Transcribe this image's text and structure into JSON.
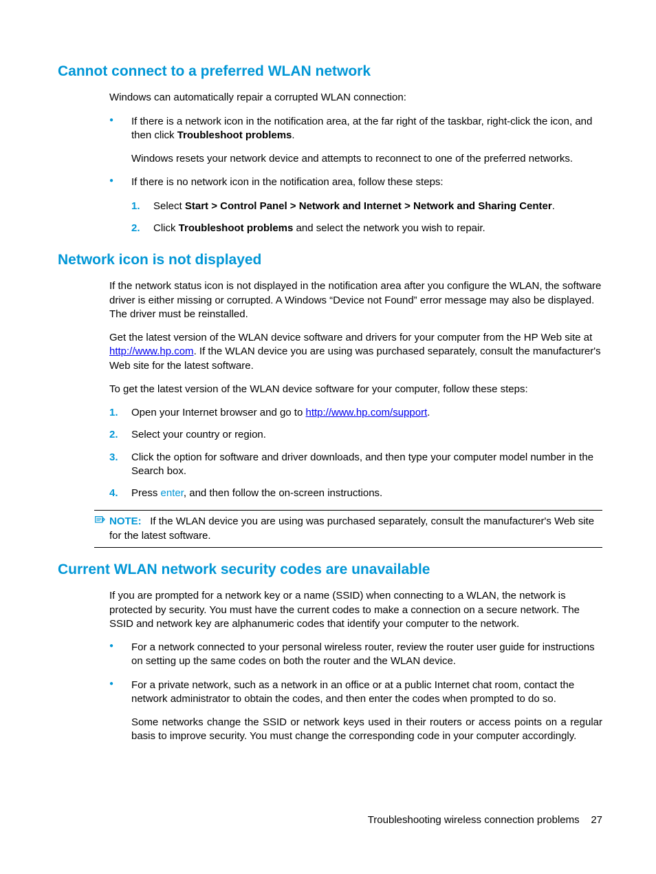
{
  "section1": {
    "heading": "Cannot connect to a preferred WLAN network",
    "intro": "Windows can automatically repair a corrupted WLAN connection:",
    "bullets": [
      {
        "text_pre": "If there is a network icon in the notification area, at the far right of the taskbar, right-click the icon, and then click ",
        "bold1": "Troubleshoot problems",
        "text_post": ".",
        "sub": "Windows resets your network device and attempts to reconnect to one of the preferred networks."
      },
      {
        "text": "If there is no network icon in the notification area, follow these steps:",
        "steps": [
          {
            "n": "1.",
            "pre": "Select ",
            "bold": "Start > Control Panel > Network and Internet > Network and Sharing Center",
            "post": "."
          },
          {
            "n": "2.",
            "pre": "Click ",
            "bold": "Troubleshoot problems",
            "post": " and select the network you wish to repair."
          }
        ]
      }
    ]
  },
  "section2": {
    "heading": "Network icon is not displayed",
    "p1": "If the network status icon is not displayed in the notification area after you configure the WLAN, the software driver is either missing or corrupted. A Windows “Device not Found” error message may also be displayed. The driver must be reinstalled.",
    "p2_pre": "Get the latest version of the WLAN device software and drivers for your computer from the HP Web site at ",
    "p2_link": "http://www.hp.com",
    "p2_post": ". If the WLAN device you are using was purchased separately, consult the manufacturer's Web site for the latest software.",
    "p3": "To get the latest version of the WLAN device software for your computer, follow these steps:",
    "steps": [
      {
        "n": "1.",
        "pre": "Open your Internet browser and go to ",
        "link": "http://www.hp.com/support",
        "post": "."
      },
      {
        "n": "2.",
        "text": "Select your country or region."
      },
      {
        "n": "3.",
        "text": "Click the option for software and driver downloads, and then type your computer model number in the Search box."
      },
      {
        "n": "4.",
        "pre": "Press ",
        "key": "enter",
        "post": ", and then follow the on-screen instructions."
      }
    ],
    "note_label": "NOTE:",
    "note_text": "If the WLAN device you are using was purchased separately, consult the manufacturer's Web site for the latest software."
  },
  "section3": {
    "heading": "Current WLAN network security codes are unavailable",
    "p1": "If you are prompted for a network key or a name (SSID) when connecting to a WLAN, the network is protected by security. You must have the current codes to make a connection on a secure network. The SSID and network key are alphanumeric codes that identify your computer to the network.",
    "bullets": [
      {
        "text": "For a network connected to your personal wireless router, review the router user guide for instructions on setting up the same codes on both the router and the WLAN device."
      },
      {
        "text": "For a private network, such as a network in an office or at a public Internet chat room, contact the network administrator to obtain the codes, and then enter the codes when prompted to do so.",
        "sub": "Some networks change the SSID or network keys used in their routers or access points on a regular basis to improve security. You must change the corresponding code in your computer accordingly."
      }
    ]
  },
  "footer": {
    "text": "Troubleshooting wireless connection problems",
    "page": "27"
  }
}
